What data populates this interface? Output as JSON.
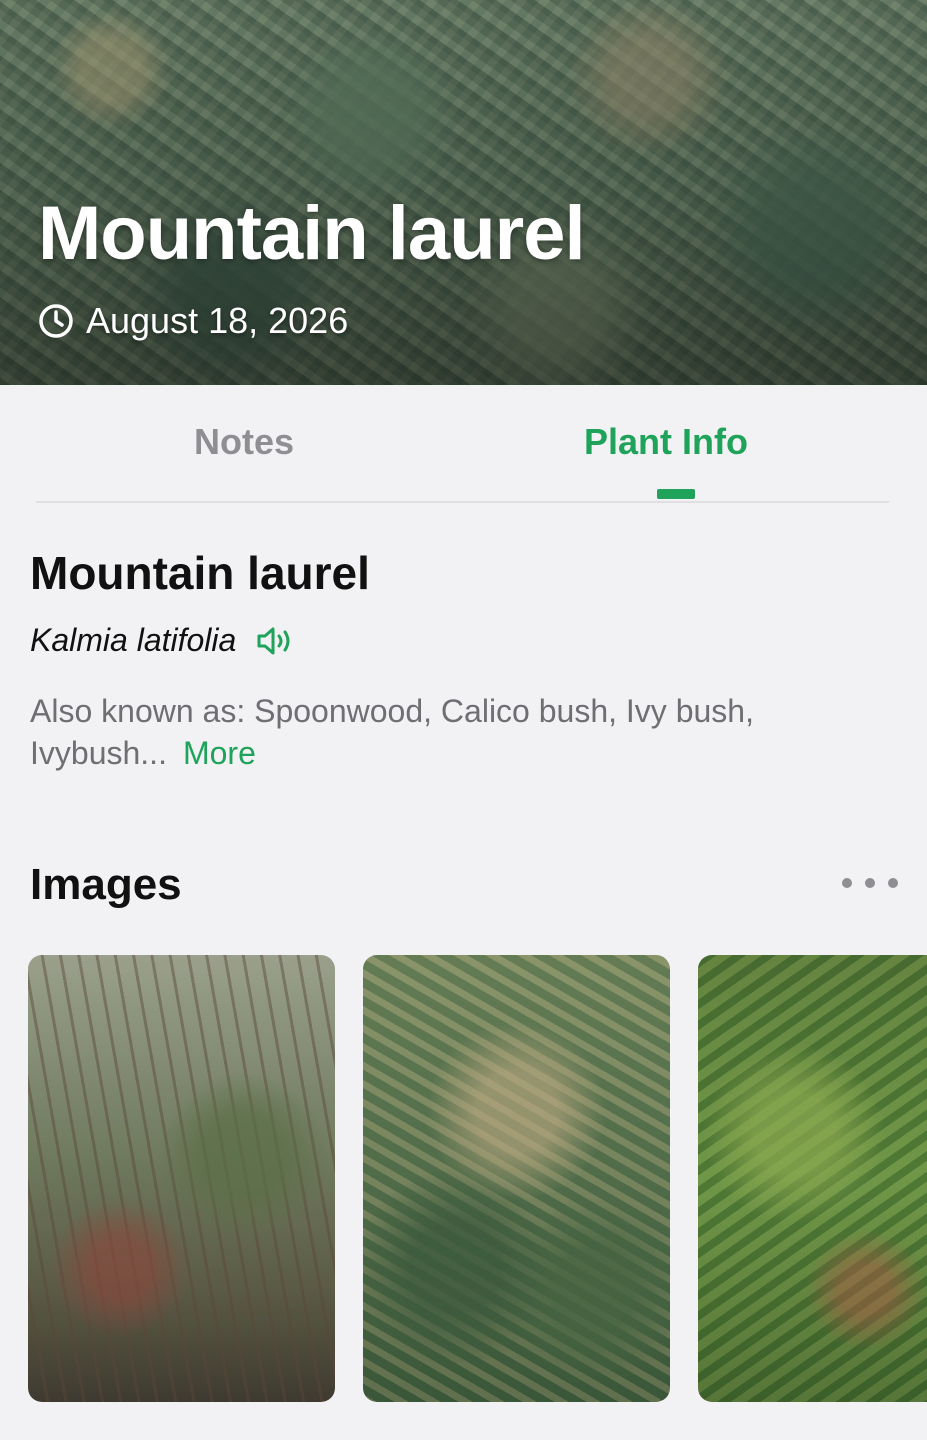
{
  "hero": {
    "title": "Mountain laurel",
    "date": "August 18, 2026",
    "date_icon": "clock-icon"
  },
  "tabs": [
    {
      "label": "Notes",
      "active": false
    },
    {
      "label": "Plant Info",
      "active": true
    }
  ],
  "accent_color": "#1fa35b",
  "plant": {
    "common_name": "Mountain laurel",
    "scientific_name": "Kalmia latifolia",
    "pronounce_icon": "speaker-icon",
    "also_known_as": "Also known as: Spoonwood, Calico bush, Ivy bush, Ivybush...",
    "more_label": "More"
  },
  "images_section": {
    "title": "Images",
    "menu_icon": "more-horizontal-icon",
    "thumbnails": [
      {
        "description_icon": "plant-photo"
      },
      {
        "description_icon": "plant-photo"
      },
      {
        "description_icon": "plant-photo"
      }
    ]
  }
}
